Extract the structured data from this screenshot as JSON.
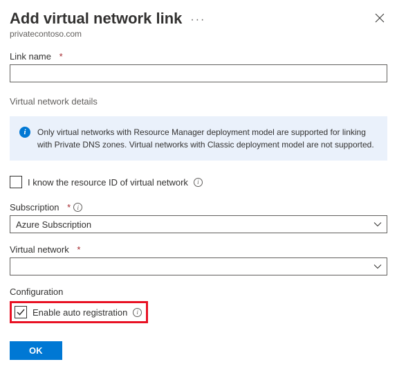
{
  "header": {
    "title": "Add virtual network link",
    "subtitle": "privatecontoso.com"
  },
  "link_name": {
    "label": "Link name",
    "value": ""
  },
  "vnet_details": {
    "section_title": "Virtual network details",
    "info_text": "Only virtual networks with Resource Manager deployment model are supported for linking with Private DNS zones. Virtual networks with Classic deployment model are not supported."
  },
  "know_resource_id": {
    "label": "I know the resource ID of virtual network"
  },
  "subscription": {
    "label": "Subscription",
    "value": "Azure Subscription"
  },
  "vnet": {
    "label": "Virtual network",
    "value": ""
  },
  "configuration": {
    "section_title": "Configuration",
    "auto_reg_label": "Enable auto registration"
  },
  "buttons": {
    "ok": "OK"
  }
}
